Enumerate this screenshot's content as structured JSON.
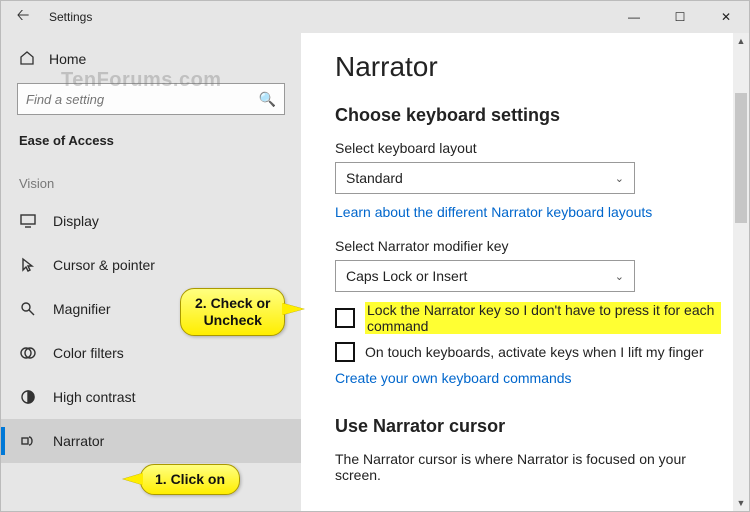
{
  "window": {
    "title": "Settings"
  },
  "watermark": "TenForums.com",
  "sidebar": {
    "home": "Home",
    "search_placeholder": "Find a setting",
    "category": "Ease of Access",
    "group": "Vision",
    "items": [
      {
        "label": "Display"
      },
      {
        "label": "Cursor & pointer"
      },
      {
        "label": "Magnifier"
      },
      {
        "label": "Color filters"
      },
      {
        "label": "High contrast"
      },
      {
        "label": "Narrator"
      }
    ]
  },
  "main": {
    "title": "Narrator",
    "section1_heading": "Choose keyboard settings",
    "layout_label": "Select keyboard layout",
    "layout_value": "Standard",
    "layout_link": "Learn about the different Narrator keyboard layouts",
    "modkey_label": "Select Narrator modifier key",
    "modkey_value": "Caps Lock or Insert",
    "check1": "Lock the Narrator key so I don't have to press it for each command",
    "check2": "On touch keyboards, activate keys when I lift my finger",
    "commands_link": "Create your own keyboard commands",
    "section2_heading": "Use Narrator cursor",
    "section2_body": "The Narrator cursor is where Narrator is focused on your screen."
  },
  "callouts": {
    "c1": "1. Click on",
    "c2_line1": "2. Check or",
    "c2_line2": "Uncheck"
  }
}
